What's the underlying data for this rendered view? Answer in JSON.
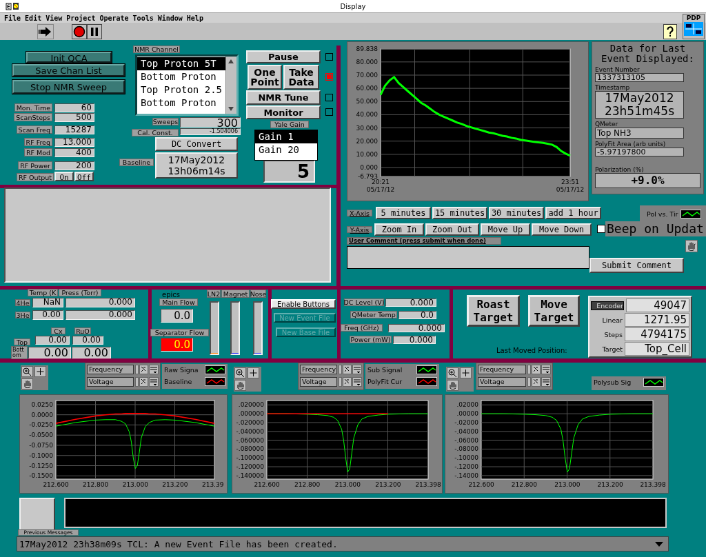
{
  "window": {
    "title": "Display"
  },
  "menu": [
    "File",
    "Edit",
    "View",
    "Project",
    "Operate",
    "Tools",
    "Window",
    "Help"
  ],
  "context_icon": {
    "label": "PDP"
  },
  "qca_buttons": [
    "Init QCA",
    "Save Chan List",
    "Stop NMR Sweep"
  ],
  "scan_settings": [
    {
      "label": "Mon. Time",
      "value": "60"
    },
    {
      "label": "ScanSteps",
      "value": "500"
    },
    {
      "label": "Scan Freq",
      "value": "15287"
    },
    {
      "label": "RF Freq",
      "value": "13.000"
    },
    {
      "label": "RF Mod",
      "value": "400"
    },
    {
      "label": "RF Power",
      "value": "200"
    }
  ],
  "rf_output": {
    "label": "RF Output",
    "buttons": [
      "On",
      "Off"
    ]
  },
  "nmr_channel": {
    "label": "NMR Channel",
    "items": [
      {
        "label": "Top Proton 5T",
        "selected": true
      },
      {
        "label": "Bottom Proton",
        "selected": false
      },
      {
        "label": "Top Proton 2.5",
        "selected": false
      },
      {
        "label": "Bottom Proton",
        "selected": false
      }
    ]
  },
  "sweeps": {
    "label": "Sweeps",
    "value": "300"
  },
  "cal_const": {
    "label": "Cal. Const.",
    "value": "-1.504006"
  },
  "dc_convert": "DC Convert",
  "baseline": {
    "label": "Baseline",
    "date": "17May2012",
    "time": "13h06m14s"
  },
  "run_controls": [
    {
      "buttons": [
        "Pause"
      ],
      "checked": false
    },
    {
      "buttons": [
        "One Point",
        "Take Data"
      ],
      "checked": true
    },
    {
      "buttons": [
        "NMR Tune"
      ],
      "checked": false
    },
    {
      "buttons": [
        "Monitor"
      ],
      "checked": false
    }
  ],
  "yale_gain": {
    "label": "Yale Gain",
    "items": [
      {
        "label": "Gain 1",
        "selected": true
      },
      {
        "label": "Gain 20",
        "selected": false
      }
    ],
    "readout": "5"
  },
  "history_chart": {
    "chart_data": {
      "type": "line",
      "grid": true,
      "categories": [
        "20:21 05/17/12",
        null,
        null,
        null,
        null,
        null,
        null,
        null,
        null,
        null,
        null,
        null,
        null,
        null,
        null,
        null,
        null,
        null,
        null,
        null,
        null,
        null,
        null,
        null,
        null,
        null,
        null,
        null,
        null,
        null,
        null,
        null,
        null,
        null,
        null,
        null,
        null,
        null,
        null,
        null,
        null,
        null,
        "23:51 05/17/12"
      ],
      "ylim": [
        -6.793,
        89.838
      ],
      "yticks": [
        {
          "value": 89.838,
          "label": "89.838"
        },
        {
          "value": 80,
          "label": "80.000"
        },
        {
          "value": 70,
          "label": "70.000"
        },
        {
          "value": 60,
          "label": "60.000"
        },
        {
          "value": 50,
          "label": "50.000"
        },
        {
          "value": 40,
          "label": "40.000"
        },
        {
          "value": 30,
          "label": "30.000"
        },
        {
          "value": 20,
          "label": "20.000"
        },
        {
          "value": 10,
          "label": "10.000"
        },
        {
          "value": 0,
          "label": "0.000"
        },
        {
          "value": -6.793,
          "label": "-6.793"
        }
      ],
      "series": [
        {
          "name": "Pol vs. Tir",
          "color": "#00ff00",
          "values": [
            55,
            62,
            66,
            68.5,
            64,
            61,
            58,
            55,
            52,
            49,
            47,
            44.5,
            42,
            40,
            38.5,
            37,
            35.5,
            34,
            33,
            31.5,
            30.5,
            29.5,
            28.5,
            27.5,
            26.5,
            26,
            25,
            24,
            23.5,
            22.5,
            22,
            21,
            20.5,
            20,
            19.5,
            19,
            18.7,
            18,
            17.3,
            15.5,
            12.5,
            10.5,
            9
          ]
        }
      ]
    }
  },
  "last_event": {
    "title": "Data for Last Event Displayed:",
    "fields": [
      {
        "label": "Event Number",
        "value": "1337313105",
        "kind": "small"
      },
      {
        "label": "Timestamp",
        "value": "17May2012 23h51m45s",
        "kind": "stamp"
      },
      {
        "label": "QMeter",
        "value": "Top NH3",
        "kind": "text"
      },
      {
        "label": "PolyFit Area (arb units)",
        "value": "-5.97197800",
        "kind": "small"
      }
    ],
    "polarization": {
      "label": "Polarization (%)",
      "value": "+9.0%"
    }
  },
  "x_axis": {
    "label": "X-Axis",
    "buttons": [
      "5 minutes",
      "15 minutes",
      "30 minutes",
      "add 1 hour"
    ]
  },
  "y_axis": {
    "label": "Y-Axis",
    "buttons": [
      "Zoom In",
      "Zoom Out",
      "Move Up",
      "Move Down"
    ]
  },
  "beep": {
    "label": "Beep on Updat",
    "checked": false
  },
  "user_comment": {
    "label": "User Comment (press submit when done)",
    "button": "Submit Comment"
  },
  "cryo": {
    "labels": [
      "Temp (K",
      "Press (Torr)"
    ],
    "rows": [
      {
        "label": "4He",
        "temp": "NaN",
        "press": "0.000"
      },
      {
        "label": "3He",
        "temp": "0.00",
        "press": "0.000"
      }
    ],
    "columns": [
      "Cx",
      "RuO"
    ],
    "sensors": [
      {
        "label": "Top",
        "values": [
          "0.00",
          "0.00"
        ]
      },
      {
        "label": "Bottom",
        "values": [
          "0.00",
          "0.00"
        ]
      }
    ]
  },
  "epics": {
    "label": "epics",
    "flows": [
      {
        "label": "Main Flow",
        "value": "0.0",
        "alarm": false
      },
      {
        "label": "Separator Flow",
        "value": "0.0",
        "alarm": true
      }
    ],
    "tanks": [
      {
        "label": "LN2",
        "level": 0.02,
        "color": "#ff8000"
      },
      {
        "label": "Magnet",
        "level": 0.02,
        "color": "#2020ff"
      },
      {
        "label": "Nose",
        "level": 0.02,
        "color": "#4040ff"
      }
    ]
  },
  "file_buttons": [
    {
      "label": "Enable Buttons",
      "disabled": false
    },
    {
      "label": "New Event File",
      "disabled": true
    },
    {
      "label": "New Base File",
      "disabled": true
    }
  ],
  "qmeter": [
    {
      "label": "DC Level (V)",
      "value": "0.000"
    },
    {
      "label": "QMeter Temp",
      "value": "0.0"
    },
    {
      "label": "Freq (GHz)",
      "value": "0.000"
    },
    {
      "label": "Power (mW)",
      "value": "0.000"
    }
  ],
  "target": {
    "buttons": [
      "Roast Target",
      "Move Target"
    ],
    "last_moved_label": "Last Moved Position:",
    "fields": [
      {
        "label": "Encoder",
        "value": "49047",
        "selected": true
      },
      {
        "label": "Linear",
        "value": "1271.95",
        "selected": false
      },
      {
        "label": "Steps",
        "value": "4794175",
        "selected": false
      },
      {
        "label": "Target",
        "value": "Top_Cell",
        "selected": false
      }
    ]
  },
  "graphs": [
    {
      "cursors": [
        "Frequency",
        "Voltage"
      ],
      "chart_data": {
        "type": "line",
        "grid": true,
        "x": [
          212.6,
          212.7,
          212.8,
          212.85,
          212.9,
          212.93,
          212.95,
          212.97,
          212.98,
          212.99,
          213.0,
          213.01,
          213.02,
          213.03,
          213.05,
          213.07,
          213.1,
          213.15,
          213.2,
          213.3,
          213.398
        ],
        "xlim": [
          212.6,
          213.398
        ],
        "ylim": [
          -0.158,
          0.035
        ],
        "xticks": [
          {
            "value": 212.6,
            "label": "212.600"
          },
          {
            "value": 212.8,
            "label": "212.800"
          },
          {
            "value": 213.0,
            "label": "213.000"
          },
          {
            "value": 213.2,
            "label": "213.200"
          },
          {
            "value": 213.39,
            "label": "213.39"
          }
        ],
        "yticks": [
          {
            "value": 0.025,
            "label": "0.0250"
          },
          {
            "value": 0,
            "label": "0.0000"
          },
          {
            "value": -0.025,
            "label": "-0.0250"
          },
          {
            "value": -0.05,
            "label": "-0.0500"
          },
          {
            "value": -0.075,
            "label": "-0.0750"
          },
          {
            "value": -0.1,
            "label": "-0.1000"
          },
          {
            "value": -0.125,
            "label": "-0.1250"
          },
          {
            "value": -0.15,
            "label": "-0.1500"
          }
        ],
        "series": [
          {
            "name": "Raw Signa",
            "color": "#00ff00",
            "values": [
              -0.028,
              -0.019,
              -0.013,
              -0.012,
              -0.012,
              -0.016,
              -0.022,
              -0.042,
              -0.067,
              -0.107,
              -0.132,
              -0.125,
              -0.092,
              -0.057,
              -0.029,
              -0.019,
              -0.013,
              -0.012,
              -0.013,
              -0.019,
              -0.028
            ]
          },
          {
            "name": "Baseline",
            "color": "#ff0000",
            "values": [
              -0.021,
              -0.011,
              -0.003,
              0,
              0.002,
              0.002,
              0.003,
              0.003,
              0.003,
              0.003,
              0.003,
              0.003,
              0.003,
              0.003,
              0.003,
              0.002,
              0.002,
              0,
              -0.003,
              -0.011,
              -0.021
            ]
          }
        ]
      }
    },
    {
      "cursors": [
        "Frequency",
        "Voltage"
      ],
      "chart_data": {
        "type": "line",
        "grid": true,
        "x": [
          212.6,
          212.7,
          212.8,
          212.85,
          212.9,
          212.93,
          212.95,
          212.97,
          212.98,
          212.99,
          213.0,
          213.01,
          213.02,
          213.03,
          213.05,
          213.07,
          213.1,
          213.15,
          213.2,
          213.3,
          213.398
        ],
        "xlim": [
          212.6,
          213.398
        ],
        "ylim": [
          -0.148,
          0.03
        ],
        "xticks": [
          {
            "value": 212.6,
            "label": "212.600"
          },
          {
            "value": 212.8,
            "label": "212.800"
          },
          {
            "value": 213.0,
            "label": "213.000"
          },
          {
            "value": 213.2,
            "label": "213.200"
          },
          {
            "value": 213.398,
            "label": "213.398"
          }
        ],
        "yticks": [
          {
            "value": 0.02,
            "label": ".020000"
          },
          {
            "value": 0,
            "label": ".000000"
          },
          {
            "value": -0.02,
            "label": "-.020000"
          },
          {
            "value": -0.04,
            "label": "-.040000"
          },
          {
            "value": -0.06,
            "label": "-.060000"
          },
          {
            "value": -0.08,
            "label": "-.080000"
          },
          {
            "value": -0.1,
            "label": "-.100000"
          },
          {
            "value": -0.12,
            "label": "-.120000"
          },
          {
            "value": -0.14,
            "label": "-.140000"
          }
        ],
        "series": [
          {
            "name": "Sub Signal",
            "color": "#00ff00",
            "values": [
              0,
              0,
              -0.001,
              -0.002,
              -0.004,
              -0.008,
              -0.015,
              -0.035,
              -0.06,
              -0.1,
              -0.132,
              -0.125,
              -0.09,
              -0.055,
              -0.025,
              -0.012,
              -0.006,
              -0.003,
              -0.001,
              0,
              0
            ]
          },
          {
            "name": "PolyFit Cur",
            "color": "#ff0000",
            "values": [
              0,
              0,
              0,
              0,
              0,
              0,
              0,
              0,
              0,
              0,
              0,
              0,
              0,
              0,
              0,
              0,
              0,
              0,
              0,
              null,
              null
            ]
          }
        ]
      }
    },
    {
      "cursors": [
        "Frequency",
        "Voltage"
      ],
      "chart_data": {
        "type": "line",
        "grid": true,
        "x": [
          212.6,
          212.7,
          212.8,
          212.85,
          212.9,
          212.93,
          212.95,
          212.97,
          212.98,
          212.99,
          213.0,
          213.01,
          213.02,
          213.03,
          213.05,
          213.07,
          213.1,
          213.15,
          213.2,
          213.3,
          213.398
        ],
        "xlim": [
          212.6,
          213.398
        ],
        "ylim": [
          -0.148,
          0.03
        ],
        "xticks": [
          {
            "value": 212.6,
            "label": "212.600"
          },
          {
            "value": 212.8,
            "label": "212.800"
          },
          {
            "value": 213.0,
            "label": "213.000"
          },
          {
            "value": 213.2,
            "label": "213.200"
          },
          {
            "value": 213.398,
            "label": "213.398"
          }
        ],
        "yticks": [
          {
            "value": 0.02,
            "label": ".02000"
          },
          {
            "value": 0,
            "label": ".00000"
          },
          {
            "value": -0.02,
            "label": "-.02000"
          },
          {
            "value": -0.04,
            "label": "-.04000"
          },
          {
            "value": -0.06,
            "label": "-.06000"
          },
          {
            "value": -0.08,
            "label": "-.08000"
          },
          {
            "value": -0.1,
            "label": "-.10000"
          },
          {
            "value": -0.12,
            "label": "-.12000"
          },
          {
            "value": -0.14,
            "label": "-.14000"
          }
        ],
        "series": [
          {
            "name": "Polysub Sig",
            "color": "#00ff00",
            "values": [
              0,
              0,
              -0.001,
              -0.002,
              -0.004,
              -0.008,
              -0.015,
              -0.035,
              -0.06,
              -0.1,
              -0.132,
              -0.125,
              -0.09,
              -0.055,
              -0.025,
              -0.012,
              -0.006,
              -0.003,
              -0.001,
              0,
              0
            ]
          }
        ]
      }
    }
  ],
  "messages": {
    "label": "Previous Messages",
    "latest": "17May2012 23h38m09s TCL: A new Event File has been created."
  }
}
